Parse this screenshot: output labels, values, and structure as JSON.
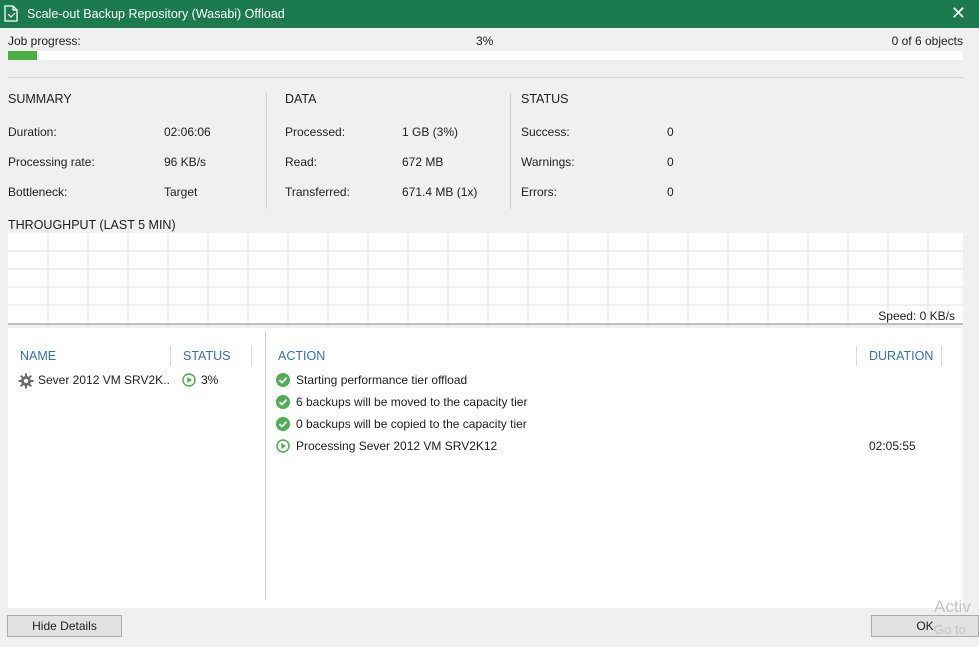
{
  "window": {
    "title": "Scale-out Backup Repository (Wasabi) Offload",
    "close_glyph": "✕",
    "icon": "document-icon"
  },
  "progress": {
    "label": "Job progress:",
    "percent_text": "3%",
    "fraction": 0.03,
    "objects_text": "0 of 6 objects",
    "bar_color": "#49b043"
  },
  "summary": {
    "heading": "SUMMARY",
    "rows": [
      {
        "label": "Duration:",
        "value": "02:06:06"
      },
      {
        "label": "Processing rate:",
        "value": "96 KB/s"
      },
      {
        "label": "Bottleneck:",
        "value": "Target"
      }
    ]
  },
  "data_section": {
    "heading": "DATA",
    "rows": [
      {
        "label": "Processed:",
        "value": "1 GB (3%)"
      },
      {
        "label": "Read:",
        "value": "672 MB"
      },
      {
        "label": "Transferred:",
        "value": "671.4 MB (1x)"
      }
    ]
  },
  "status_section": {
    "heading": "STATUS",
    "rows": [
      {
        "label": "Success:",
        "value": "0"
      },
      {
        "label": "Warnings:",
        "value": "0"
      },
      {
        "label": "Errors:",
        "value": "0"
      }
    ]
  },
  "throughput": {
    "title": "THROUGHPUT (LAST 5 MIN)",
    "speed_text": "Speed: 0 KB/s"
  },
  "objects_table": {
    "headers": {
      "name": "NAME",
      "status": "STATUS"
    },
    "rows": [
      {
        "name": "Sever 2012 VM SRV2K...",
        "status": "3%",
        "icon": "gear-icon",
        "status_icon": "play-icon"
      }
    ]
  },
  "actions_table": {
    "headers": {
      "action": "ACTION",
      "duration": "DURATION"
    },
    "rows": [
      {
        "icon": "success-check-icon",
        "text": "Starting performance tier offload",
        "duration": ""
      },
      {
        "icon": "success-check-icon",
        "text": "6 backups will be moved to the capacity tier",
        "duration": ""
      },
      {
        "icon": "success-check-icon",
        "text": "0 backups will be copied to the capacity tier",
        "duration": ""
      },
      {
        "icon": "play-icon",
        "text": "Processing Sever 2012 VM SRV2K12",
        "duration": "02:05:55"
      }
    ]
  },
  "buttons": {
    "hide_details": "Hide Details",
    "ok": "OK"
  },
  "watermark": {
    "line1": "Activ",
    "line2": "Go to"
  },
  "colors": {
    "titlebar": "#1b7b4f",
    "header_blue": "#2e74b5",
    "success_green": "#4caf50"
  }
}
